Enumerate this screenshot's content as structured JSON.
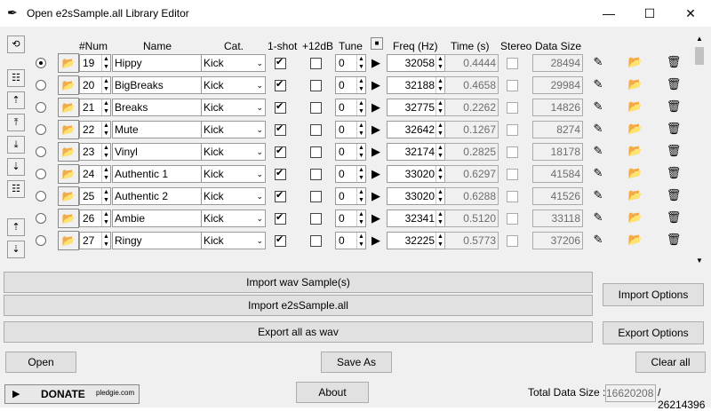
{
  "window": {
    "title": "Open e2sSample.all Library Editor",
    "minimize": "—",
    "maximize": "☐",
    "close": "✕"
  },
  "headers": {
    "num": "#Num",
    "name": "Name",
    "cat": "Cat.",
    "oneshot": "1-shot",
    "plus12db": "+12dB",
    "tune": "Tune",
    "freq": "Freq (Hz)",
    "time": "Time (s)",
    "stereo": "Stereo",
    "datasize": "Data Size"
  },
  "rows": [
    {
      "num": "19",
      "name": "Hippy",
      "cat": "Kick",
      "oneshot": true,
      "tune": "0",
      "freq": "32058",
      "time": "0.4444",
      "size": "28494",
      "selected": true
    },
    {
      "num": "20",
      "name": "BigBreaks",
      "cat": "Kick",
      "oneshot": true,
      "tune": "0",
      "freq": "32188",
      "time": "0.4658",
      "size": "29984",
      "selected": false
    },
    {
      "num": "21",
      "name": "Breaks",
      "cat": "Kick",
      "oneshot": true,
      "tune": "0",
      "freq": "32775",
      "time": "0.2262",
      "size": "14826",
      "selected": false
    },
    {
      "num": "22",
      "name": "Mute",
      "cat": "Kick",
      "oneshot": true,
      "tune": "0",
      "freq": "32642",
      "time": "0.1267",
      "size": "8274",
      "selected": false
    },
    {
      "num": "23",
      "name": "Vinyl",
      "cat": "Kick",
      "oneshot": true,
      "tune": "0",
      "freq": "32174",
      "time": "0.2825",
      "size": "18178",
      "selected": false
    },
    {
      "num": "24",
      "name": "Authentic 1",
      "cat": "Kick",
      "oneshot": true,
      "tune": "0",
      "freq": "33020",
      "time": "0.6297",
      "size": "41584",
      "selected": false
    },
    {
      "num": "25",
      "name": "Authentic 2",
      "cat": "Kick",
      "oneshot": true,
      "tune": "0",
      "freq": "33020",
      "time": "0.6288",
      "size": "41526",
      "selected": false
    },
    {
      "num": "26",
      "name": "Ambie",
      "cat": "Kick",
      "oneshot": true,
      "tune": "0",
      "freq": "32341",
      "time": "0.5120",
      "size": "33118",
      "selected": false
    },
    {
      "num": "27",
      "name": "Ringy",
      "cat": "Kick",
      "oneshot": true,
      "tune": "0",
      "freq": "32225",
      "time": "0.5773",
      "size": "37206",
      "selected": false
    }
  ],
  "buttons": {
    "import_wav": "Import wav Sample(s)",
    "import_all": "Import e2sSample.all",
    "export_wav": "Export all as wav",
    "import_options": "Import Options",
    "export_options": "Export Options",
    "open": "Open",
    "save_as": "Save As",
    "clear_all": "Clear all",
    "about": "About",
    "donate": "DONATE",
    "donate_brand": "pledgie.com"
  },
  "footer": {
    "total_label": "Total Data Size :",
    "total_value": "16620208",
    "total_max": "/ 26214396"
  },
  "icons": {
    "refresh": "⟲",
    "folder": "📂",
    "play": "▶",
    "edit": "✎",
    "trash": "🗑",
    "stop": "■"
  }
}
